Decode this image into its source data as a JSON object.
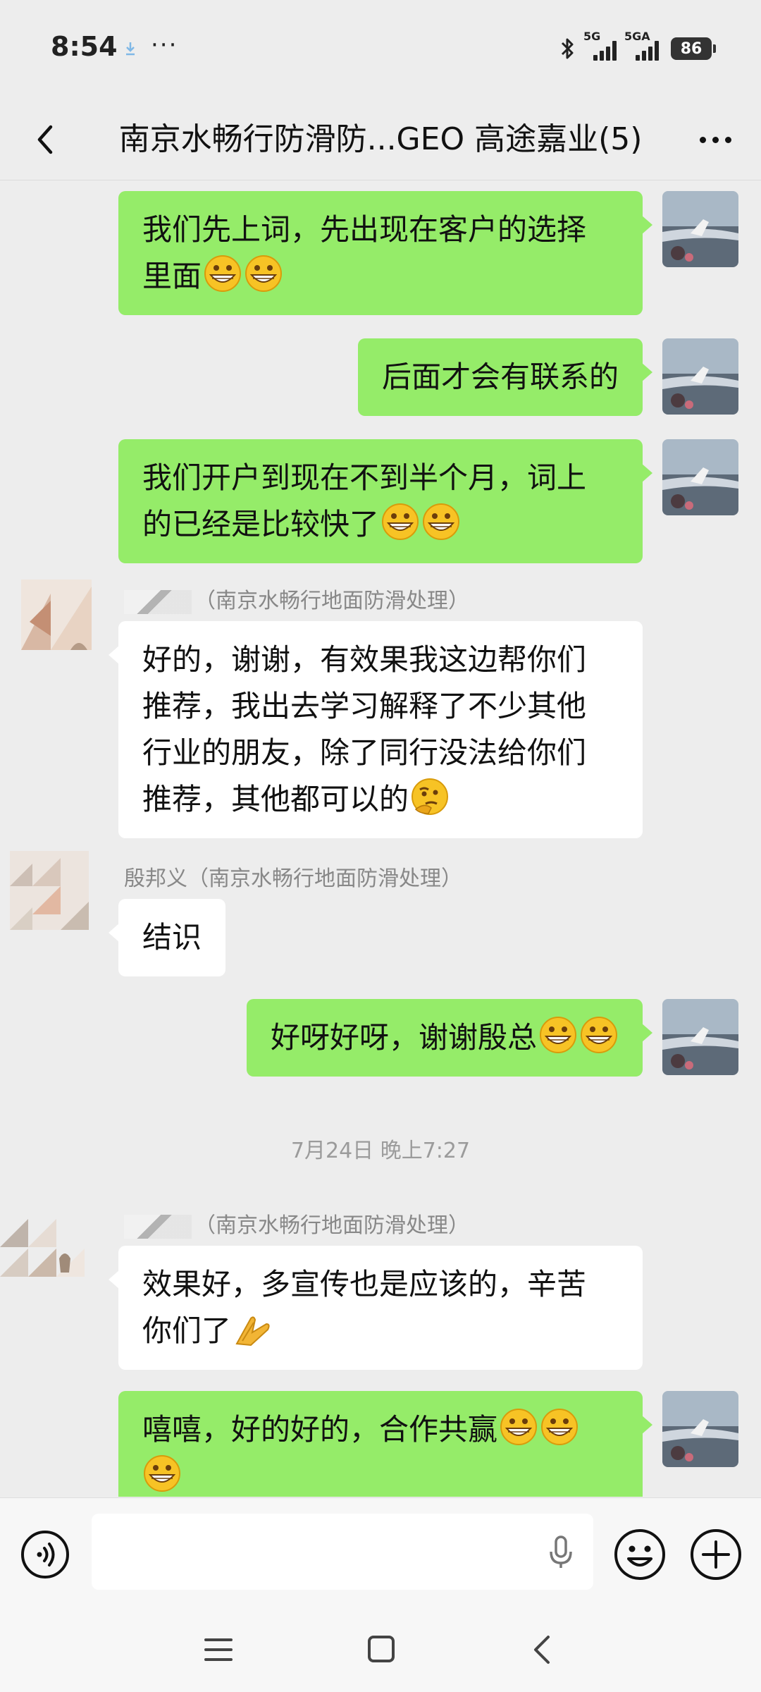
{
  "status_bar": {
    "time": "8:54",
    "dots": "···",
    "signal1_label": "5G",
    "signal2_label": "5GA",
    "battery": "86"
  },
  "nav": {
    "title": "南京水畅行防滑防...GEO 高途嘉业(5)"
  },
  "messages": [
    {
      "from": "me",
      "line1": "我们先上词，先出现在客户的选择",
      "line2": "里面",
      "emoji": "grinning-face-emoji x2"
    },
    {
      "from": "me",
      "text": "后面才会有联系的"
    },
    {
      "from": "me",
      "line1": "我们开户到现在不到半个月，词上",
      "line2": "的已经是比较快了",
      "emoji": "grinning-face-emoji x2"
    },
    {
      "from": "other",
      "sender": "（南京水畅行地面防滑处理）",
      "line1": "好的，谢谢，有效果我这边帮你们",
      "line2": "推荐，我出去学习解释了不少其他",
      "line3": "行业的朋友，除了同行没法给你们",
      "line4": "推荐，其他都可以的",
      "emoji": "thinking-face-emoji"
    },
    {
      "from": "other",
      "sender": "殷邦义（南京水畅行地面防滑处理）",
      "text": "结识"
    },
    {
      "from": "me",
      "text": "好呀好呀，谢谢殷总",
      "emoji": "grinning-face-emoji x2"
    },
    {
      "from": "other",
      "sender": "（南京水畅行地面防滑处理）",
      "line1": "效果好，多宣传也是应该的，辛苦",
      "line2": "你们了",
      "emoji": "praying-hands-emoji"
    },
    {
      "from": "me",
      "text": "嘻嘻，好的好的，合作共赢",
      "emoji": "grinning-face-emoji x3"
    }
  ],
  "timestamp": "7月24日 晚上7:27",
  "colors": {
    "background": "#ededed",
    "my_bubble": "#95ec69",
    "other_bubble": "#ffffff",
    "timestamp": "#9b9b9b"
  }
}
